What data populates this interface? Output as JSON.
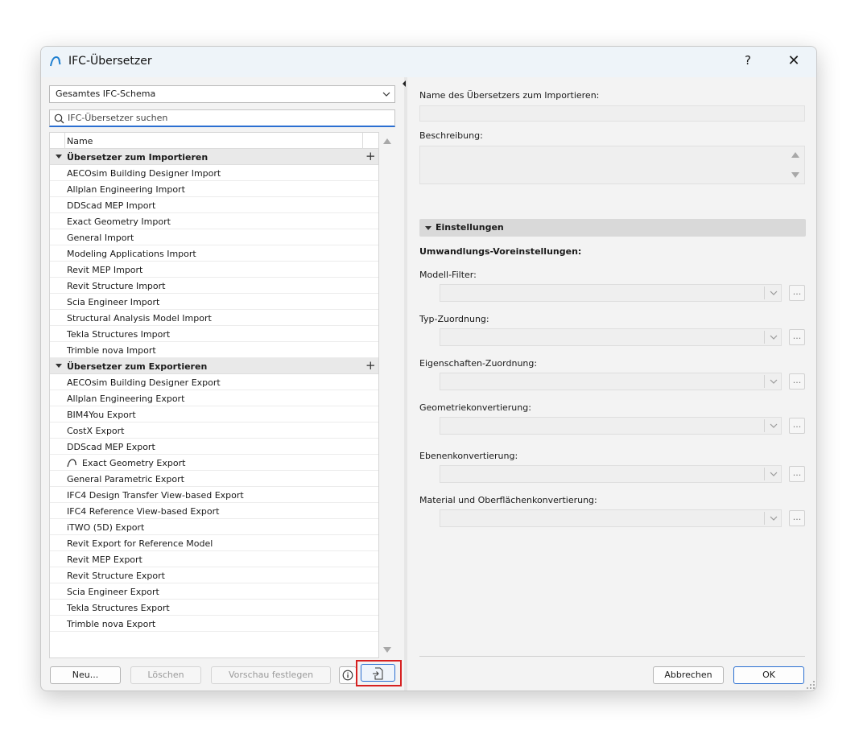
{
  "window": {
    "title": "IFC-Übersetzer",
    "help_label": "?",
    "close_label": "✕"
  },
  "left": {
    "schema_select": "Gesamtes IFC-Schema",
    "search_placeholder": "IFC-Übersetzer suchen",
    "column_header": "Name",
    "groups": [
      {
        "label": "Übersetzer zum Importieren",
        "items": [
          "AECOsim Building Designer Import",
          "Allplan Engineering Import",
          "DDScad MEP Import",
          "Exact Geometry Import",
          "General Import",
          "Modeling Applications Import",
          "Revit MEP Import",
          "Revit Structure Import",
          "Scia Engineer Import",
          "Structural Analysis Model Import",
          "Tekla Structures Import",
          "Trimble nova Import"
        ]
      },
      {
        "label": "Übersetzer zum Exportieren",
        "items": [
          "AECOsim Building Designer Export",
          "Allplan Engineering Export",
          "BIM4You Export",
          "CostX Export",
          "DDScad MEP Export",
          "Exact Geometry Export",
          "General Parametric Export",
          "IFC4 Design Transfer View-based Export",
          "IFC4 Reference View-based Export",
          "iTWO (5D) Export",
          "Revit Export for Reference Model",
          "Revit MEP Export",
          "Revit Structure Export",
          "Scia Engineer Export",
          "Tekla Structures Export",
          "Trimble nova Export"
        ]
      }
    ],
    "buttons": {
      "new": "Neu...",
      "delete": "Löschen",
      "preview": "Vorschau festlegen"
    }
  },
  "right": {
    "name_label": "Name des Übersetzers zum Importieren:",
    "description_label": "Beschreibung:",
    "section_label": "Einstellungen",
    "presets_label": "Umwandlungs-Voreinstellungen:",
    "fields": [
      "Modell-Filter:",
      "Typ-Zuordnung:",
      "Eigenschaften-Zuordnung:",
      "Geometriekonvertierung:",
      "Ebenenkonvertierung:",
      "Material und Oberflächenkonvertierung:"
    ],
    "dots_label": "...",
    "cancel": "Abbrechen",
    "ok": "OK"
  },
  "colors": {
    "accent": "#2b6fd1",
    "highlight": "#d62020",
    "titlebar": "#eef4f9"
  }
}
